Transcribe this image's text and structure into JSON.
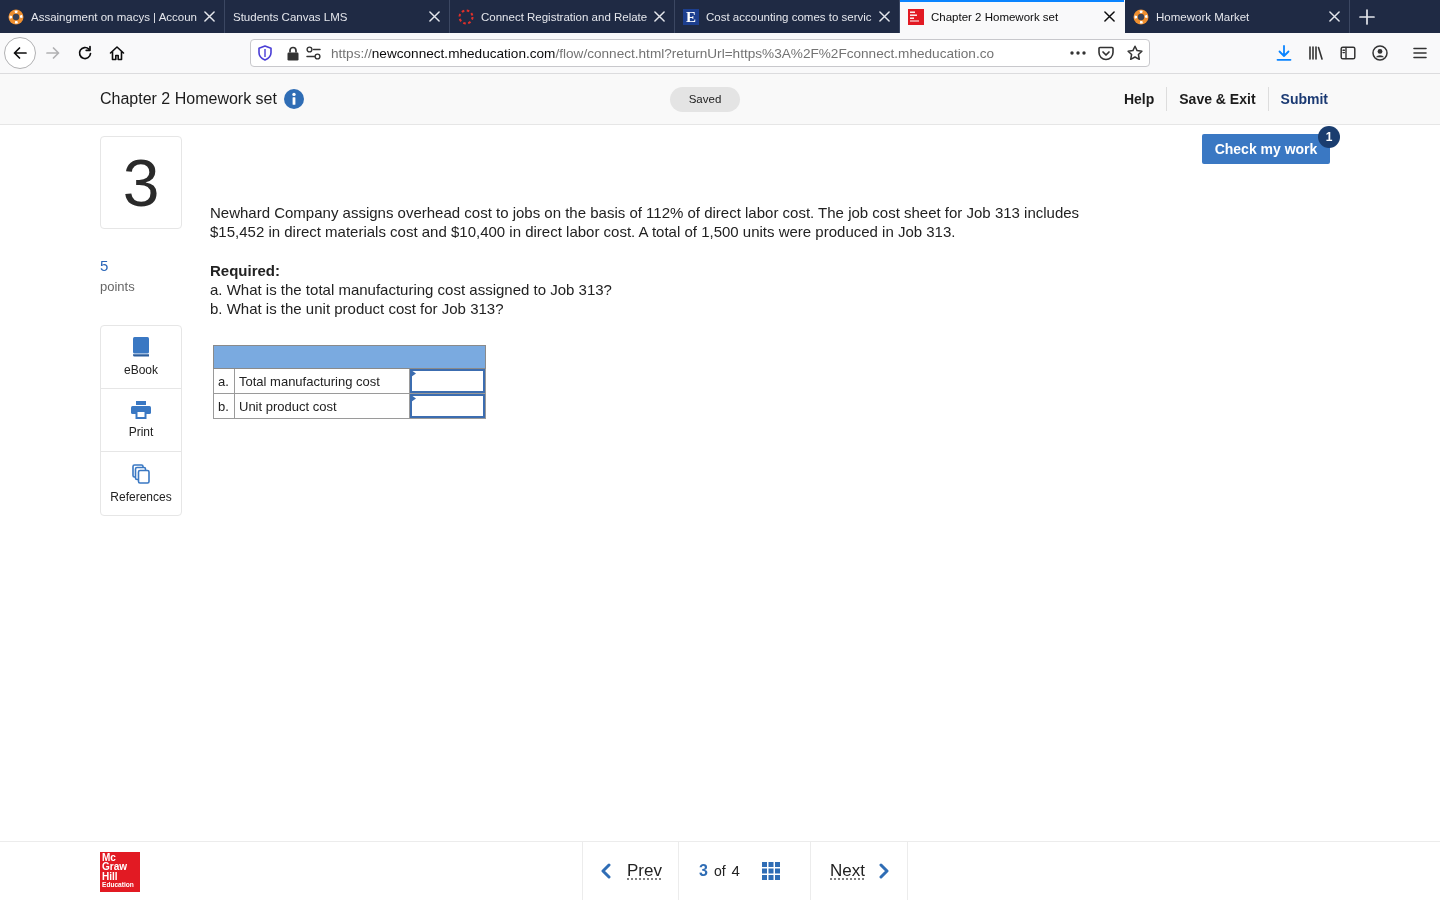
{
  "browser": {
    "tabs": [
      {
        "title": "Assaingment on macys | Accoun",
        "kind": "lifebuoy",
        "selected": false
      },
      {
        "title": "Students Canvas LMS",
        "kind": "plain",
        "selected": false
      },
      {
        "title": "Connect Registration and Relate",
        "kind": "spinner",
        "selected": false
      },
      {
        "title": "Cost accounting comes to servic",
        "kind": "letter",
        "letter": "E",
        "selected": false
      },
      {
        "title": "Chapter 2 Homework set",
        "kind": "publisher",
        "selected": true
      },
      {
        "title": "Homework Market",
        "kind": "lifebuoy",
        "selected": false
      }
    ],
    "forward": {
      "disabled": true
    },
    "address": {
      "scheme": "https://",
      "host": "newconnect.mheducation.com",
      "path": "/flow/connect.html?returnUrl=https%3A%2F%2Fconnect.mheducation.co"
    }
  },
  "header": {
    "title": "Chapter 2 Homework set",
    "status": "Saved",
    "links": [
      {
        "label": "Help",
        "kind": "plain"
      },
      {
        "label": "Save & Exit",
        "kind": "plain"
      },
      {
        "label": "Submit",
        "kind": "primary"
      }
    ]
  },
  "question": {
    "number": "3",
    "points": "5",
    "points_label": "points",
    "tools": [
      {
        "label": "eBook",
        "kind": "book"
      },
      {
        "label": "Print",
        "kind": "printer"
      },
      {
        "label": "References",
        "kind": "copies"
      }
    ],
    "prompt": "Newhard Company assigns overhead cost to jobs on the basis of 112% of direct labor cost. The job cost sheet for Job 313 includes $15,452 in direct materials cost and $10,400 in direct labor cost. A total of 1,500 units were produced in Job 313.",
    "required": {
      "heading": "Required:",
      "items": [
        "a. What is the total manufacturing cost assigned to Job 313?",
        "b. What is the unit product cost for Job 313?"
      ]
    },
    "answer_table": {
      "rows": [
        {
          "letter": "a.",
          "label": "Total manufacturing cost"
        },
        {
          "letter": "b.",
          "label": "Unit product cost"
        }
      ]
    }
  },
  "check_work": {
    "label": "Check my work",
    "badge": "1"
  },
  "footer": {
    "logo": [
      "Mc",
      "Graw",
      "Hill",
      "Education"
    ],
    "prev": "Prev",
    "page": {
      "current": "3",
      "of": "of",
      "total": "4"
    },
    "next": "Next"
  }
}
